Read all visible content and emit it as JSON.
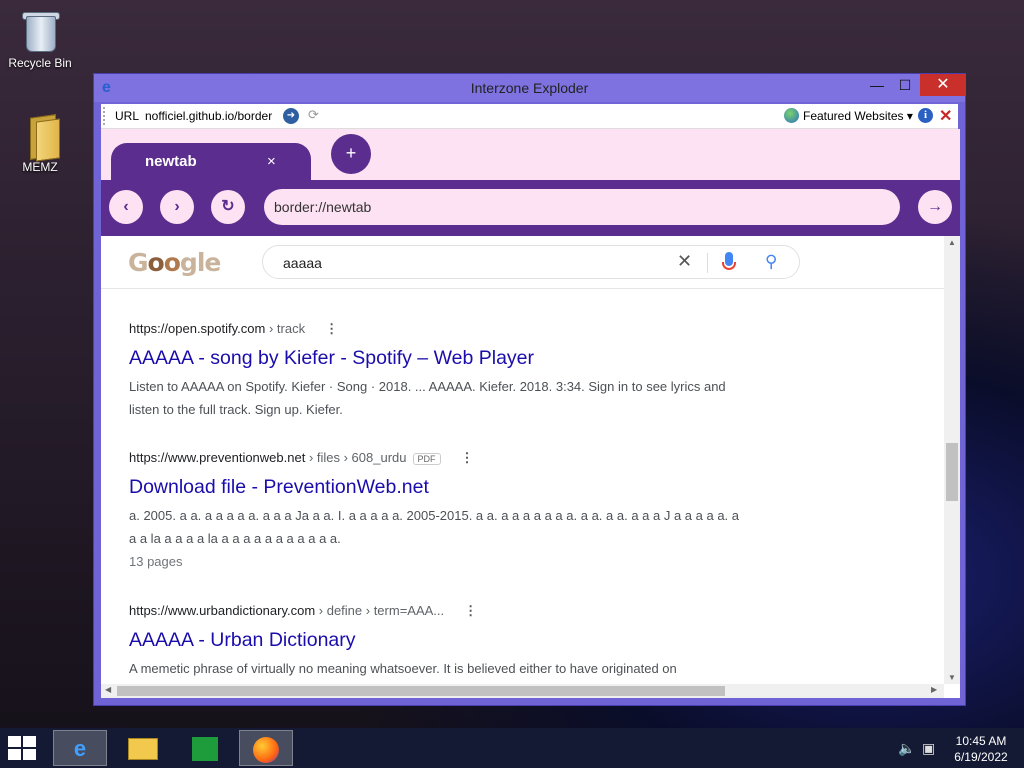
{
  "desktop": {
    "icons": [
      {
        "label": "Recycle Bin",
        "icon": "recycle-bin-icon"
      },
      {
        "label": "MEMZ",
        "icon": "folder-icon"
      }
    ]
  },
  "window": {
    "title": "Interzone Exploder",
    "icon": "ie-logo-icon",
    "controls": {
      "minimize": "—",
      "maximize": "☐",
      "close": "✕"
    }
  },
  "toolbar": {
    "url_label": "URL",
    "url_value": "nofficiel.github.io/border",
    "featured_label": "Featured Websites ▾"
  },
  "browser": {
    "tabs": [
      {
        "label": "newtab",
        "close": "×"
      }
    ],
    "new_tab_symbol": "+",
    "address": "border://newtab"
  },
  "google": {
    "logo_text": "Google",
    "query": "aaaaa",
    "clear_symbol": "✕"
  },
  "results": [
    {
      "url": "https://open.spotify.com",
      "crumbs": " › track",
      "title": "AAAAA - song by Kiefer - Spotify – Web Player",
      "snippet": "Listen to AAAAA on Spotify. Kiefer · Song · 2018. ... AAAAA. Kiefer. 2018. 3:34. Sign in to see lyrics and listen to the full track. Sign up. Kiefer."
    },
    {
      "url": "https://www.preventionweb.net",
      "crumbs": " › files › 608_urdu",
      "badge": "PDF",
      "title": "Download file - PreventionWeb.net",
      "snippet": "a. 2005. a a. a a a a a. a a a Ja a a. I. a a a a a. 2005-2015. a a. a a a a a a a. a a. a a. a a a J a a a a a. a a a la a a a a la a a a a a a a a a a a.",
      "meta": "13 pages"
    },
    {
      "url": "https://www.urbandictionary.com",
      "crumbs": " › define › term=AAA...",
      "title": "AAAAA - Urban Dictionary",
      "snippet": "A memetic phrase of virtually no meaning whatsoever. It is believed either to have originated on"
    }
  ],
  "taskbar": {
    "items": [
      "ie-icon",
      "file-explorer-icon",
      "store-icon",
      "firefox-icon"
    ],
    "time": "10:45 AM",
    "date": "6/19/2022"
  },
  "colors": {
    "accent": "#5b2d8e",
    "tab_bg": "#fde2f3",
    "window_frame": "#6f63d6",
    "link": "#1a0dab"
  }
}
